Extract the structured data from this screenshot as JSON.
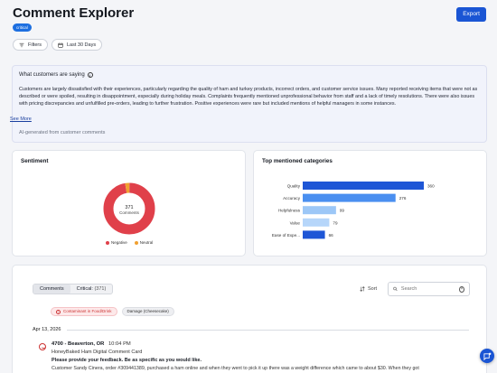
{
  "header": {
    "title": "Comment Explorer",
    "export_label": "Export",
    "badge": "critical"
  },
  "filters": {
    "filters_label": "Filters",
    "range_label": "Last 30 Days"
  },
  "summary": {
    "heading": "What customers are saying",
    "text": "Customers are largely dissatisfied with their experiences, particularly regarding the quality of ham and turkey products, incorrect orders, and customer service issues. Many reported receiving items that were not as described or were spoiled, resulting in disappointment, especially during holiday meals. Complaints frequently mentioned unprofessional behavior from staff and a lack of timely resolutions. There were also issues with pricing discrepancies and unfulfilled pre-orders, leading to further frustration. Positive experiences were rare but included mentions of helpful managers in some instances.",
    "see_more": "See More",
    "ai_note": "AI-generated from customer comments"
  },
  "sentiment": {
    "title": "Sentiment",
    "total": "371",
    "total_label": "Comments",
    "legend": [
      {
        "label": "Negative",
        "color": "#e0404a"
      },
      {
        "label": "Neutral",
        "color": "#f0a030"
      }
    ]
  },
  "categories": {
    "title": "Top mentioned categories"
  },
  "chart_data": [
    {
      "type": "pie",
      "title": "Sentiment",
      "labels": [
        "Negative",
        "Neutral"
      ],
      "values": [
        361,
        10
      ],
      "colors": [
        "#e0404a",
        "#f0a030"
      ],
      "center_text": "371 Comments"
    },
    {
      "type": "bar",
      "orientation": "horizontal",
      "title": "Top mentioned categories",
      "categories": [
        "Quality",
        "Accuracy",
        "Helpfulness",
        "Value",
        "Ease of Expe..."
      ],
      "values": [
        360,
        276,
        99,
        79,
        66
      ],
      "colors": [
        "#1e56d6",
        "#4a8ff0",
        "#9cc7f7",
        "#b6d6fa",
        "#1e56d6"
      ],
      "xlim": [
        0,
        360
      ]
    }
  ],
  "comments": {
    "tab_comments": "Comments",
    "tab_critical": "Critical:",
    "tab_critical_count": "(371)",
    "sort_label": "Sort",
    "search_placeholder": "Search",
    "chips": [
      "Contaminant in Food/Drink",
      "Damage (Cheesecake)"
    ],
    "date": "Apr 13, 2026",
    "entry": {
      "location": "4700 - Beaverton, OR",
      "time": "10:04 PM",
      "card": "HoneyBaked Ham Digital Comment Card",
      "question": "Please provide your feedback. Be as specific as you would like.",
      "body": "Customer Sandy Cinera, order #309441389, purchased a ham online and when they went to pick it up there was a weight difference which came to about $30. When they got"
    }
  }
}
